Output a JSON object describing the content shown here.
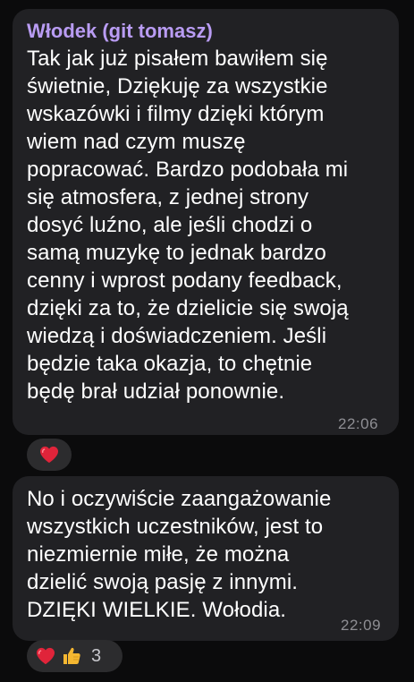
{
  "messages": [
    {
      "sender": "Włodek (git tomasz)",
      "text": "Tak jak już pisałem bawiłem się\nświetnie, Dziękuję za wszystkie\nwskazówki i filmy dzięki którym\nwiem nad czym muszę\npopracować. Bardzo podobała mi\nsię atmosfera, z jednej strony\ndosyć luźno, ale jeśli chodzi o\nsamą muzykę to jednak bardzo\ncenny i wprost podany feedback,\ndzięki za to, że dzielicie się swoją\nwiedzą i doświadczeniem. Jeśli\nbędzie taka okazja, to chętnie\nbędę brał udział ponownie.",
      "time": "22:06",
      "reactions": [
        {
          "icon": "red-heart-icon"
        }
      ]
    },
    {
      "sender": "",
      "text": "No i oczywiście zaangażowanie\nwszystkich uczestników, jest to\nniezmiernie miłe, że można\ndzielić swoją pasję z innymi.\nDZIĘKI WIELKIE. Wołodia.",
      "time": "22:09",
      "reactions": [
        {
          "icon": "red-heart-icon"
        },
        {
          "icon": "thumbs-up-icon"
        }
      ],
      "reaction_count": "3"
    }
  ],
  "colors": {
    "background": "#0b0b0c",
    "bubble": "#212124",
    "sender_name": "#b99cf3",
    "timestamp": "#8e8e93",
    "heart": "#e0243a",
    "thumb": "#f5b731"
  }
}
